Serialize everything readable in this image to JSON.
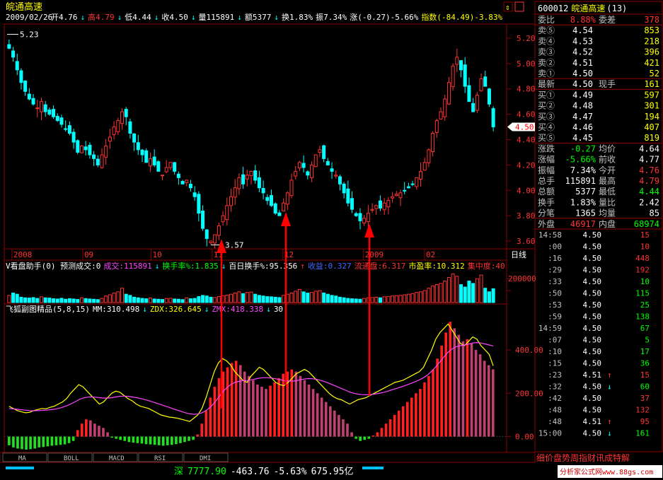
{
  "stock_title": "皖通高速",
  "info_bar": {
    "date": "2009/02/26",
    "items": [
      {
        "text": "开4.76",
        "color": "#ffffff"
      },
      {
        "text": "↓",
        "color": "#00ffff"
      },
      {
        "text": "高4.79",
        "color": "#ff3333"
      },
      {
        "text": "↓",
        "color": "#00ffff"
      },
      {
        "text": "低4.44",
        "color": "#ffffff"
      },
      {
        "text": "↓",
        "color": "#00ffff"
      },
      {
        "text": "收4.50",
        "color": "#ffffff"
      },
      {
        "text": "↓",
        "color": "#00ffff"
      },
      {
        "text": "量115891",
        "color": "#ffffff"
      },
      {
        "text": "↓",
        "color": "#00ffff"
      },
      {
        "text": "额5377",
        "color": "#ffffff"
      },
      {
        "text": "↓",
        "color": "#00ffff"
      },
      {
        "text": "换1.83%",
        "color": "#ffffff"
      },
      {
        "text": "振7.34%",
        "color": "#ffffff"
      },
      {
        "text": "涨(-0.27)-5.66%",
        "color": "#ffffff"
      },
      {
        "text": "指数(-84.49)-3.83%",
        "color": "#ffff00"
      }
    ]
  },
  "price_markers": {
    "high": "5.23",
    "low": "3.57",
    "current": "4.50"
  },
  "x_axis_labels": [
    {
      "label": "2008",
      "pos": 0.01
    },
    {
      "label": "09",
      "pos": 0.155
    },
    {
      "label": "10",
      "pos": 0.295
    },
    {
      "label": "11",
      "pos": 0.42
    },
    {
      "label": "12",
      "pos": 0.565
    },
    {
      "label": "2009",
      "pos": 0.73
    },
    {
      "label": "02",
      "pos": 0.855
    }
  ],
  "period_label": "日线",
  "volume_header": [
    {
      "text": "V看盘助手(0) 预测成交:0",
      "color": "#ffffff"
    },
    {
      "text": "成交:115891",
      "color": "#ff44ff"
    },
    {
      "text": "↓",
      "color": "#00ffff"
    },
    {
      "text": "换手率%:1.835",
      "color": "#00ff00"
    },
    {
      "text": "↓",
      "color": "#00ffff"
    },
    {
      "text": "百日换手%:95.356",
      "color": "#ffffff"
    },
    {
      "text": "↑",
      "color": "#ff3333"
    },
    {
      "text": "收益:0.327",
      "color": "#4466ff"
    },
    {
      "text": "流通盘:6.317",
      "color": "#ff3333"
    },
    {
      "text": "市盈率:10.312",
      "color": "#ffff00"
    },
    {
      "text": "集中度:40",
      "color": "#ff3333"
    }
  ],
  "indicator_header": [
    {
      "text": "飞狐副图精品(5,8,15)",
      "color": "#ffffff"
    },
    {
      "text": "MM:310.498",
      "color": "#ffffff"
    },
    {
      "text": "↓",
      "color": "#00ffff"
    },
    {
      "text": "ZDX:326.645",
      "color": "#ffff00"
    },
    {
      "text": "↓",
      "color": "#00ffff"
    },
    {
      "text": "ZMX:418.338",
      "color": "#ff44ff"
    },
    {
      "text": "↓",
      "color": "#00ffff"
    },
    {
      "text": "30",
      "color": "#ffffff"
    }
  ],
  "tabs": [
    "MA",
    "BOLL",
    "MACD",
    "RSI",
    "DMI"
  ],
  "status_bar": {
    "index_name": "深",
    "index_value": "7777.90",
    "change": "-463.76",
    "pct": "-5.63%",
    "amount": "675.95亿",
    "watermark": "分析家公式网www.88gs.com"
  },
  "right_panel": {
    "code": "600012",
    "name": "皖通高速",
    "count": "(13)",
    "weibi": {
      "label": "委比",
      "value": "8.88%",
      "label2": "委差",
      "value2": "378"
    },
    "sells": [
      {
        "label": "卖⑤",
        "price": "4.54",
        "vol": "853"
      },
      {
        "label": "卖④",
        "price": "4.53",
        "vol": "218"
      },
      {
        "label": "卖③",
        "price": "4.52",
        "vol": "396"
      },
      {
        "label": "卖②",
        "price": "4.51",
        "vol": "421"
      },
      {
        "label": "卖①",
        "price": "4.50",
        "vol": "52"
      }
    ],
    "latest": {
      "label": "最新",
      "price": "4.50",
      "label2": "现手",
      "vol": "161"
    },
    "buys": [
      {
        "label": "买①",
        "price": "4.49",
        "vol": "597"
      },
      {
        "label": "买②",
        "price": "4.48",
        "vol": "301"
      },
      {
        "label": "买③",
        "price": "4.47",
        "vol": "194"
      },
      {
        "label": "买④",
        "price": "4.46",
        "vol": "407"
      },
      {
        "label": "买⑤",
        "price": "4.45",
        "vol": "819"
      }
    ],
    "stats": [
      {
        "l1": "涨跌",
        "v1": "-0.27",
        "c1": "#00ff00",
        "l2": "均价",
        "v2": "4.64",
        "c2": "#ffffff"
      },
      {
        "l1": "涨幅",
        "v1": "-5.66%",
        "c1": "#00ff00",
        "l2": "前收",
        "v2": "4.77",
        "c2": "#ffffff"
      },
      {
        "l1": "振幅",
        "v1": "7.34%",
        "c1": "#ffffff",
        "l2": "今开",
        "v2": "4.76",
        "c2": "#ff3333"
      },
      {
        "l1": "总手",
        "v1": "115891",
        "c1": "#ffffff",
        "l2": "最高",
        "v2": "4.79",
        "c2": "#ff3333"
      },
      {
        "l1": "总额",
        "v1": "5377",
        "c1": "#ffffff",
        "l2": "最低",
        "v2": "4.44",
        "c2": "#00ff00"
      },
      {
        "l1": "换手",
        "v1": "1.83%",
        "c1": "#ffffff",
        "l2": "量比",
        "v2": "2.42",
        "c2": "#ffffff"
      },
      {
        "l1": "分笔",
        "v1": "1365",
        "c1": "#ffffff",
        "l2": "均量",
        "v2": "85",
        "c2": "#ffffff"
      }
    ],
    "outer_inner": {
      "l1": "外盘",
      "v1": "46917",
      "l2": "内盘",
      "v2": "68974"
    },
    "ticks": [
      {
        "time": "14:58",
        "price": "4.50",
        "arrow": "",
        "vol": "15",
        "vc": "#ff3333"
      },
      {
        "time": ":00",
        "price": "4.50",
        "arrow": "",
        "vol": "10",
        "vc": "#ff3333"
      },
      {
        "time": ":16",
        "price": "4.50",
        "arrow": "",
        "vol": "448",
        "vc": "#ff3333"
      },
      {
        "time": ":29",
        "price": "4.50",
        "arrow": "",
        "vol": "192",
        "vc": "#ff3333"
      },
      {
        "time": ":33",
        "price": "4.50",
        "arrow": "",
        "vol": "10",
        "vc": "#00ff00"
      },
      {
        "time": ":50",
        "price": "4.50",
        "arrow": "",
        "vol": "115",
        "vc": "#00ff00"
      },
      {
        "time": ":53",
        "price": "4.50",
        "arrow": "",
        "vol": "25",
        "vc": "#00ff00"
      },
      {
        "time": ":59",
        "price": "4.50",
        "arrow": "",
        "vol": "138",
        "vc": "#00ff00"
      },
      {
        "time": "14:59",
        "price": "4.50",
        "arrow": "",
        "vol": "67",
        "vc": "#00ff00"
      },
      {
        "time": ":07",
        "price": "4.50",
        "arrow": "",
        "vol": "5",
        "vc": "#00ff00"
      },
      {
        "time": ":10",
        "price": "4.50",
        "arrow": "",
        "vol": "17",
        "vc": "#00ff00"
      },
      {
        "time": ":15",
        "price": "4.50",
        "arrow": "",
        "vol": "36",
        "vc": "#00ff00"
      },
      {
        "time": ":23",
        "price": "4.51",
        "arrow": "↑",
        "vol": "15",
        "vc": "#ff3333"
      },
      {
        "time": ":32",
        "price": "4.50",
        "arrow": "↓",
        "vol": "60",
        "vc": "#00ff00"
      },
      {
        "time": ":42",
        "price": "4.50",
        "arrow": "",
        "vol": "37",
        "vc": "#ff3333"
      },
      {
        "time": ":48",
        "price": "4.50",
        "arrow": "",
        "vol": "132",
        "vc": "#ff3333"
      },
      {
        "time": ":48",
        "price": "4.51",
        "arrow": "↑",
        "vol": "95",
        "vc": "#ff3333"
      },
      {
        "time": "15:00",
        "price": "4.50",
        "arrow": "↓",
        "vol": "161",
        "vc": "#00ff00"
      }
    ],
    "bottom_tabs": "细价盘势周指财讯成特解"
  },
  "colors": {
    "up": "#ff3333",
    "down": "#00ffff",
    "grid": "#8b0000",
    "axis_text": "#ff3333",
    "arrow": "#ff0000"
  },
  "chart_data": [
    {
      "type": "candlestick",
      "title": "皖通高速",
      "ylim": [
        3.55,
        5.3
      ],
      "yticks": [
        3.6,
        3.8,
        4.0,
        4.2,
        4.4,
        4.6,
        4.8,
        5.0,
        5.2
      ],
      "close": [
        5.12,
        5.05,
        4.95,
        4.85,
        4.78,
        4.72,
        4.68,
        4.65,
        4.7,
        4.62,
        4.6,
        4.58,
        4.55,
        4.52,
        4.48,
        4.45,
        4.38,
        4.3,
        4.35,
        4.32,
        4.28,
        4.25,
        4.2,
        4.28,
        4.35,
        4.42,
        4.5,
        4.55,
        4.62,
        4.58,
        4.45,
        4.38,
        4.32,
        4.28,
        4.22,
        4.25,
        4.2,
        4.15,
        4.12,
        4.18,
        4.22,
        4.15,
        4.1,
        4.05,
        4.08,
        4.02,
        3.95,
        3.82,
        3.7,
        3.62,
        3.6,
        3.65,
        3.72,
        3.8,
        3.88,
        3.95,
        4.02,
        4.1,
        4.05,
        4.12,
        4.15,
        4.08,
        4.02,
        3.98,
        3.92,
        3.88,
        3.82,
        3.8,
        3.9,
        3.98,
        4.08,
        4.15,
        4.22,
        4.18,
        4.12,
        4.2,
        4.28,
        4.32,
        4.25,
        4.2,
        4.15,
        4.12,
        4.05,
        3.98,
        3.9,
        3.85,
        3.8,
        3.76,
        3.78,
        3.82,
        3.85,
        3.88,
        3.86,
        3.9,
        3.92,
        3.95,
        3.97,
        3.98,
        4.0,
        4.02,
        4.05,
        4.1,
        4.15,
        4.22,
        4.32,
        4.45,
        4.55,
        4.62,
        4.72,
        4.85,
        4.98,
        5.05,
        4.95,
        4.82,
        4.7,
        4.62,
        4.75,
        4.88,
        4.82,
        4.68,
        4.5
      ]
    },
    {
      "type": "bar",
      "title": "V看盘助手",
      "ylim": [
        0,
        260000
      ],
      "yticks": [
        200000,
        100000
      ],
      "values": [
        60000,
        80000,
        70000,
        45000,
        40000,
        38000,
        42000,
        35000,
        48000,
        40000,
        38000,
        32000,
        30000,
        36000,
        28000,
        33000,
        30000,
        26000,
        40000,
        34000,
        30000,
        28000,
        25000,
        35000,
        55000,
        65000,
        80000,
        90000,
        120000,
        70000,
        60000,
        45000,
        40000,
        35000,
        32000,
        38000,
        30000,
        28000,
        26000,
        34000,
        36000,
        30000,
        28000,
        25000,
        40000,
        32000,
        35000,
        50000,
        60000,
        55000,
        45000,
        42000,
        50000,
        58000,
        62000,
        70000,
        80000,
        90000,
        75000,
        85000,
        88000,
        70000,
        60000,
        55000,
        50000,
        48000,
        45000,
        42000,
        60000,
        70000,
        80000,
        95000,
        110000,
        90000,
        80000,
        85000,
        95000,
        100000,
        80000,
        70000,
        60000,
        55000,
        45000,
        40000,
        35000,
        32000,
        30000,
        28000,
        35000,
        40000,
        42000,
        45000,
        40000,
        48000,
        50000,
        55000,
        58000,
        60000,
        65000,
        70000,
        75000,
        85000,
        90000,
        100000,
        120000,
        140000,
        150000,
        160000,
        180000,
        210000,
        240000,
        220000,
        150000,
        130000,
        180000,
        160000,
        200000,
        230000,
        120000,
        90000,
        115891
      ]
    },
    {
      "type": "bar",
      "title": "飞狐副图精品(5,8,15)",
      "ylim": [
        -60,
        560
      ],
      "yticks": [
        0,
        200,
        400
      ],
      "series": [
        {
          "name": "ZDX",
          "values": [
            140,
            130,
            120,
            115,
            110,
            112,
            120,
            125,
            130,
            128,
            135,
            140,
            150,
            160,
            175,
            200,
            220,
            240,
            230,
            210,
            190,
            170,
            150,
            160,
            180,
            200,
            210,
            205,
            190,
            175,
            165,
            150,
            140,
            135,
            130,
            120,
            110,
            100,
            95,
            90,
            88,
            85,
            80,
            75,
            70,
            85,
            100,
            130,
            180,
            240,
            300,
            340,
            360,
            350,
            330,
            300,
            280,
            260,
            250,
            280,
            300,
            320,
            310,
            290,
            270,
            250,
            240,
            235,
            250,
            270,
            290,
            300,
            310,
            300,
            280,
            260,
            240,
            220,
            200,
            185,
            175,
            170,
            160,
            150,
            160,
            170,
            175,
            180,
            190,
            200,
            210,
            220,
            230,
            240,
            250,
            255,
            260,
            270,
            280,
            290,
            300,
            320,
            360,
            400,
            450,
            480,
            500,
            520,
            490,
            460,
            430,
            420,
            440,
            460,
            450,
            420,
            400,
            380,
            326.645
          ]
        },
        {
          "name": "ZMX",
          "values": [
            130,
            128,
            126,
            124,
            122,
            120,
            119,
            120,
            121,
            122,
            124,
            126,
            130,
            135,
            142,
            150,
            160,
            170,
            178,
            182,
            183,
            182,
            180,
            178,
            178,
            180,
            183,
            186,
            187,
            186,
            183,
            180,
            176,
            171,
            166,
            160,
            154,
            148,
            141,
            135,
            128,
            122,
            116,
            110,
            105,
            103,
            104,
            110,
            120,
            135,
            155,
            180,
            205,
            225,
            240,
            250,
            255,
            258,
            259,
            262,
            266,
            270,
            272,
            272,
            270,
            267,
            263,
            259,
            257,
            256,
            258,
            262,
            266,
            268,
            267,
            264,
            259,
            253,
            246,
            238,
            230,
            222,
            214,
            206,
            200,
            196,
            194,
            193,
            194,
            196,
            199,
            203,
            208,
            214,
            220,
            226,
            232,
            239,
            246,
            254,
            262,
            272,
            285,
            302,
            322,
            345,
            368,
            390,
            405,
            415,
            420,
            423,
            427,
            432,
            434,
            432,
            428,
            423,
            418.338
          ]
        },
        {
          "name": "MM",
          "values": [
            -40,
            -50,
            -55,
            -58,
            -60,
            -58,
            -55,
            -50,
            -48,
            -45,
            -42,
            -40,
            -38,
            -36,
            -30,
            -20,
            30,
            60,
            80,
            75,
            60,
            50,
            40,
            20,
            -5,
            -10,
            -15,
            -20,
            -25,
            -28,
            -30,
            -32,
            -35,
            -36,
            -38,
            -40,
            -42,
            -40,
            -38,
            -35,
            -30,
            -25,
            -20,
            -15,
            10,
            60,
            120,
            180,
            230,
            270,
            300,
            320,
            340,
            350,
            330,
            300,
            280,
            260,
            240,
            230,
            220,
            235,
            250,
            270,
            290,
            300,
            310,
            300,
            280,
            260,
            240,
            220,
            200,
            180,
            160,
            140,
            120,
            100,
            80,
            60,
            20,
            -10,
            -20,
            -15,
            -10,
            5,
            20,
            40,
            60,
            80,
            100,
            120,
            140,
            160,
            180,
            200,
            220,
            250,
            280,
            310,
            360,
            420,
            480,
            530,
            500,
            470,
            440,
            450,
            430,
            400,
            380,
            350,
            330,
            310.498
          ]
        }
      ]
    }
  ]
}
